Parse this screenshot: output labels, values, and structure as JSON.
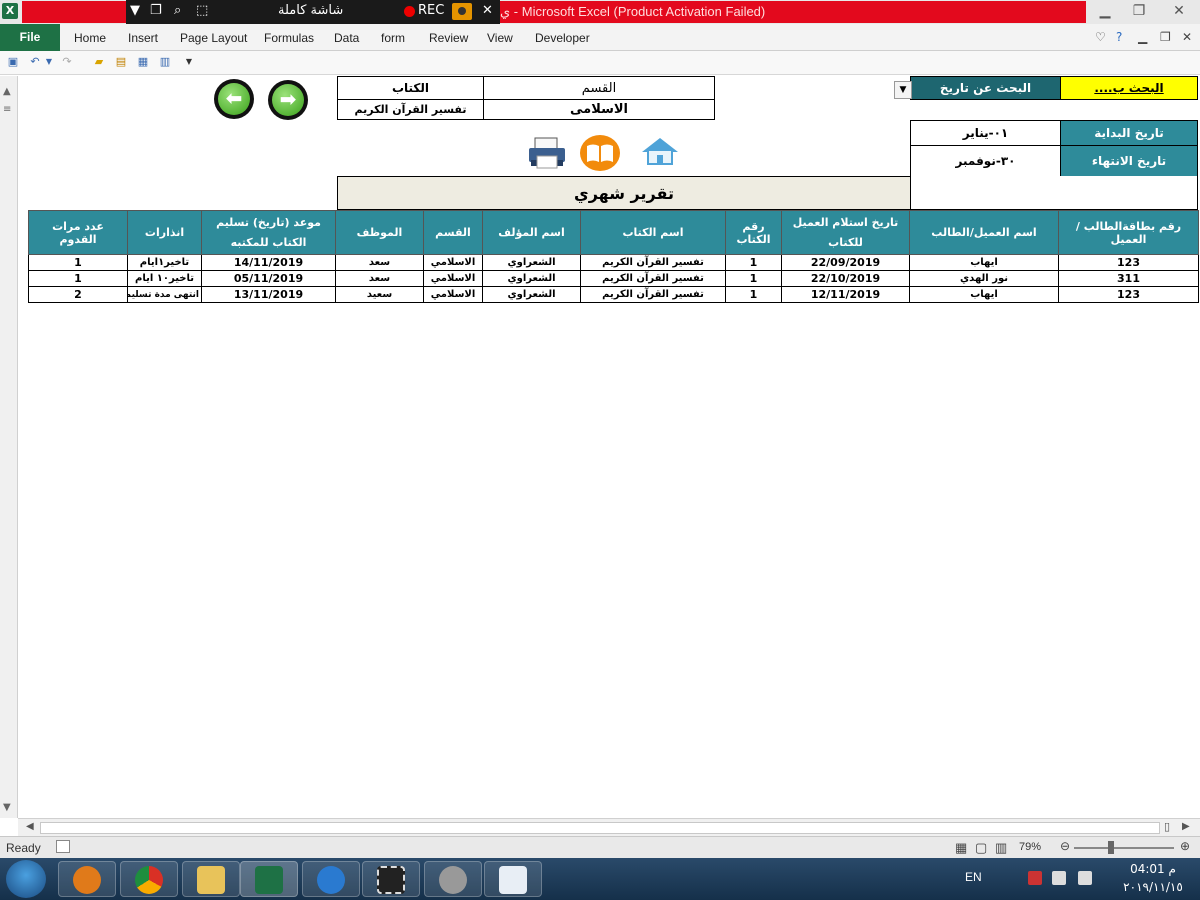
{
  "window": {
    "title": "Microsoft Excel (Product Activation Failed)",
    "title_prefix": "ي  -",
    "recorder_label": "شاشة كاملة",
    "recorder_rec": "REC"
  },
  "ribbon": {
    "file_label": "File",
    "tabs": [
      "Home",
      "Insert",
      "Page Layout",
      "Formulas",
      "Data",
      "form",
      "Review",
      "View",
      "Developer"
    ]
  },
  "search": {
    "label": "البحث ب....",
    "by_date": "البحث عن تاريخ",
    "start_label": "تاريخ البداية",
    "start_value": "٠١-يناير",
    "end_label": "تاريخ الانتهاء",
    "end_value": "٣٠-نوفمبر"
  },
  "filter": {
    "section_header": "القسم",
    "section_value": "الاسلامى",
    "book_header": "الكتاب",
    "book_value": "تفسير القرآن الكريم"
  },
  "report": {
    "title": "تقرير شهري",
    "headers": [
      "رقم بطاقةالطالب /العميل",
      "اسم العميل/الطالب",
      "تاريخ استلام العميل للكتاب",
      "رقم الكتاب",
      "اسم الكتاب",
      "اسم المؤلف",
      "القسم",
      "الموظف",
      "موعد (تاريخ) تسليم الكتاب للمكتبه",
      "انذارات",
      "عدد مرات القدوم"
    ],
    "rows": [
      [
        "123",
        "ايهاب",
        "22/09/2019",
        "1",
        "تفسير القرآن الكريم",
        "الشعراوي",
        "الاسلامي",
        "سعد",
        "14/11/2019",
        "تاخير١ايام",
        "1"
      ],
      [
        "311",
        "نور الهدي",
        "22/10/2019",
        "1",
        "تفسير القرآن الكريم",
        "الشعراوي",
        "الاسلامي",
        "سعد",
        "05/11/2019",
        "تاخير١٠ ايام",
        "1"
      ],
      [
        "123",
        "ايهاب",
        "12/11/2019",
        "1",
        "تفسير القرآن الكريم",
        "الشعراوي",
        "الاسلامي",
        "سعيد",
        "13/11/2019",
        "انتهى مدة تسليم الكتاب",
        "2"
      ]
    ]
  },
  "status": {
    "ready": "Ready",
    "zoom": "79%"
  },
  "taskbar": {
    "language": "EN",
    "time": "04:01 م",
    "date": "٢٠١٩/١١/١٥"
  },
  "colors": {
    "header_teal": "#2e8b9a",
    "search_yellow": "#ffff00",
    "title_red": "#e3091d",
    "report_title_bg": "#eeece1"
  }
}
